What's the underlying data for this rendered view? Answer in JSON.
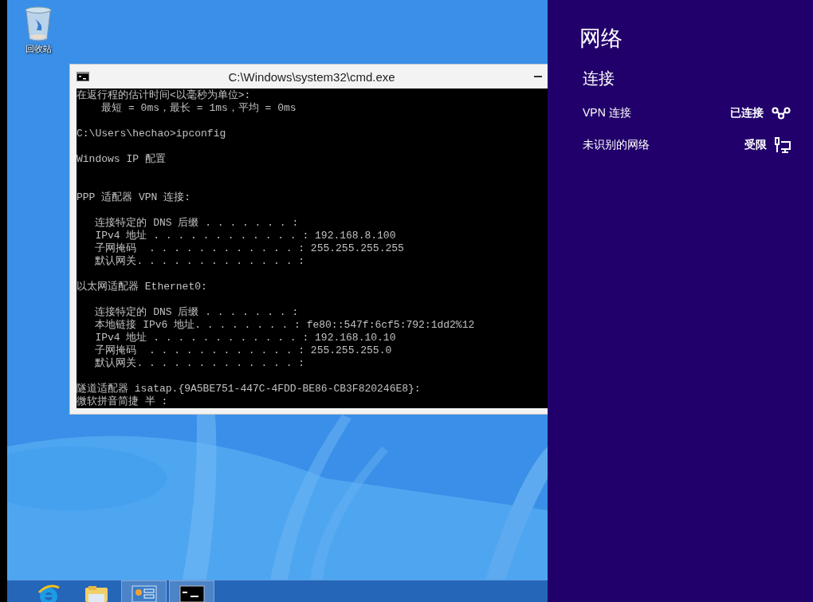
{
  "desktop_icons": [
    {
      "label": "回收站",
      "kind": "recycle-bin"
    }
  ],
  "console_window": {
    "title": "C:\\Windows\\system32\\cmd.exe",
    "lines": [
      {
        "kind": "text",
        "text": "在返行程的估计时间<以毫秒为单位>:"
      },
      {
        "kind": "text",
        "text": "    最短 = 0ms，最长 = 1ms，平均 = 0ms"
      },
      {
        "kind": "blank"
      },
      {
        "kind": "text",
        "text": "C:\\Users\\hechao>ipconfig"
      },
      {
        "kind": "blank"
      },
      {
        "kind": "text",
        "text": "Windows IP 配置"
      },
      {
        "kind": "blank"
      },
      {
        "kind": "blank"
      },
      {
        "kind": "text",
        "text": "PPP 适配器 VPN 连接:"
      },
      {
        "kind": "blank"
      },
      {
        "kind": "text",
        "text": "   连接特定的 DNS 后缀 . . . . . . . :"
      },
      {
        "kind": "text",
        "text": "   IPv4 地址 . . . . . . . . . . . . : 192.168.8.100"
      },
      {
        "kind": "text",
        "text": "   子网掩码  . . . . . . . . . . . . : 255.255.255.255"
      },
      {
        "kind": "text",
        "text": "   默认网关. . . . . . . . . . . . . :"
      },
      {
        "kind": "blank"
      },
      {
        "kind": "text",
        "text": "以太网适配器 Ethernet0:"
      },
      {
        "kind": "blank"
      },
      {
        "kind": "text",
        "text": "   连接特定的 DNS 后缀 . . . . . . . :"
      },
      {
        "kind": "text",
        "text": "   本地链接 IPv6 地址. . . . . . . . : fe80::547f:6cf5:792:1dd2%12"
      },
      {
        "kind": "text",
        "text": "   IPv4 地址 . . . . . . . . . . . . : 192.168.10.10"
      },
      {
        "kind": "text",
        "text": "   子网掩码  . . . . . . . . . . . . : 255.255.255.0"
      },
      {
        "kind": "text",
        "text": "   默认网关. . . . . . . . . . . . . :"
      },
      {
        "kind": "blank"
      },
      {
        "kind": "text",
        "text": "隧道适配器 isatap.{9A5BE751-447C-4FDD-BE86-CB3F820246E8}:"
      },
      {
        "kind": "text",
        "text": "微软拼音简捷 半 :"
      }
    ]
  },
  "taskbar": {
    "items": [
      {
        "kind": "browser",
        "running": false
      },
      {
        "kind": "folder",
        "running": false
      },
      {
        "kind": "server-manager",
        "running": true
      },
      {
        "kind": "console",
        "running": true
      }
    ]
  },
  "network_panel": {
    "title": "网络",
    "section": "连接",
    "connections": [
      {
        "name": "VPN 连接",
        "status": "已连接",
        "kind": "vpn"
      },
      {
        "name": "未识别的网络",
        "status": "受限",
        "kind": "wired"
      }
    ]
  }
}
